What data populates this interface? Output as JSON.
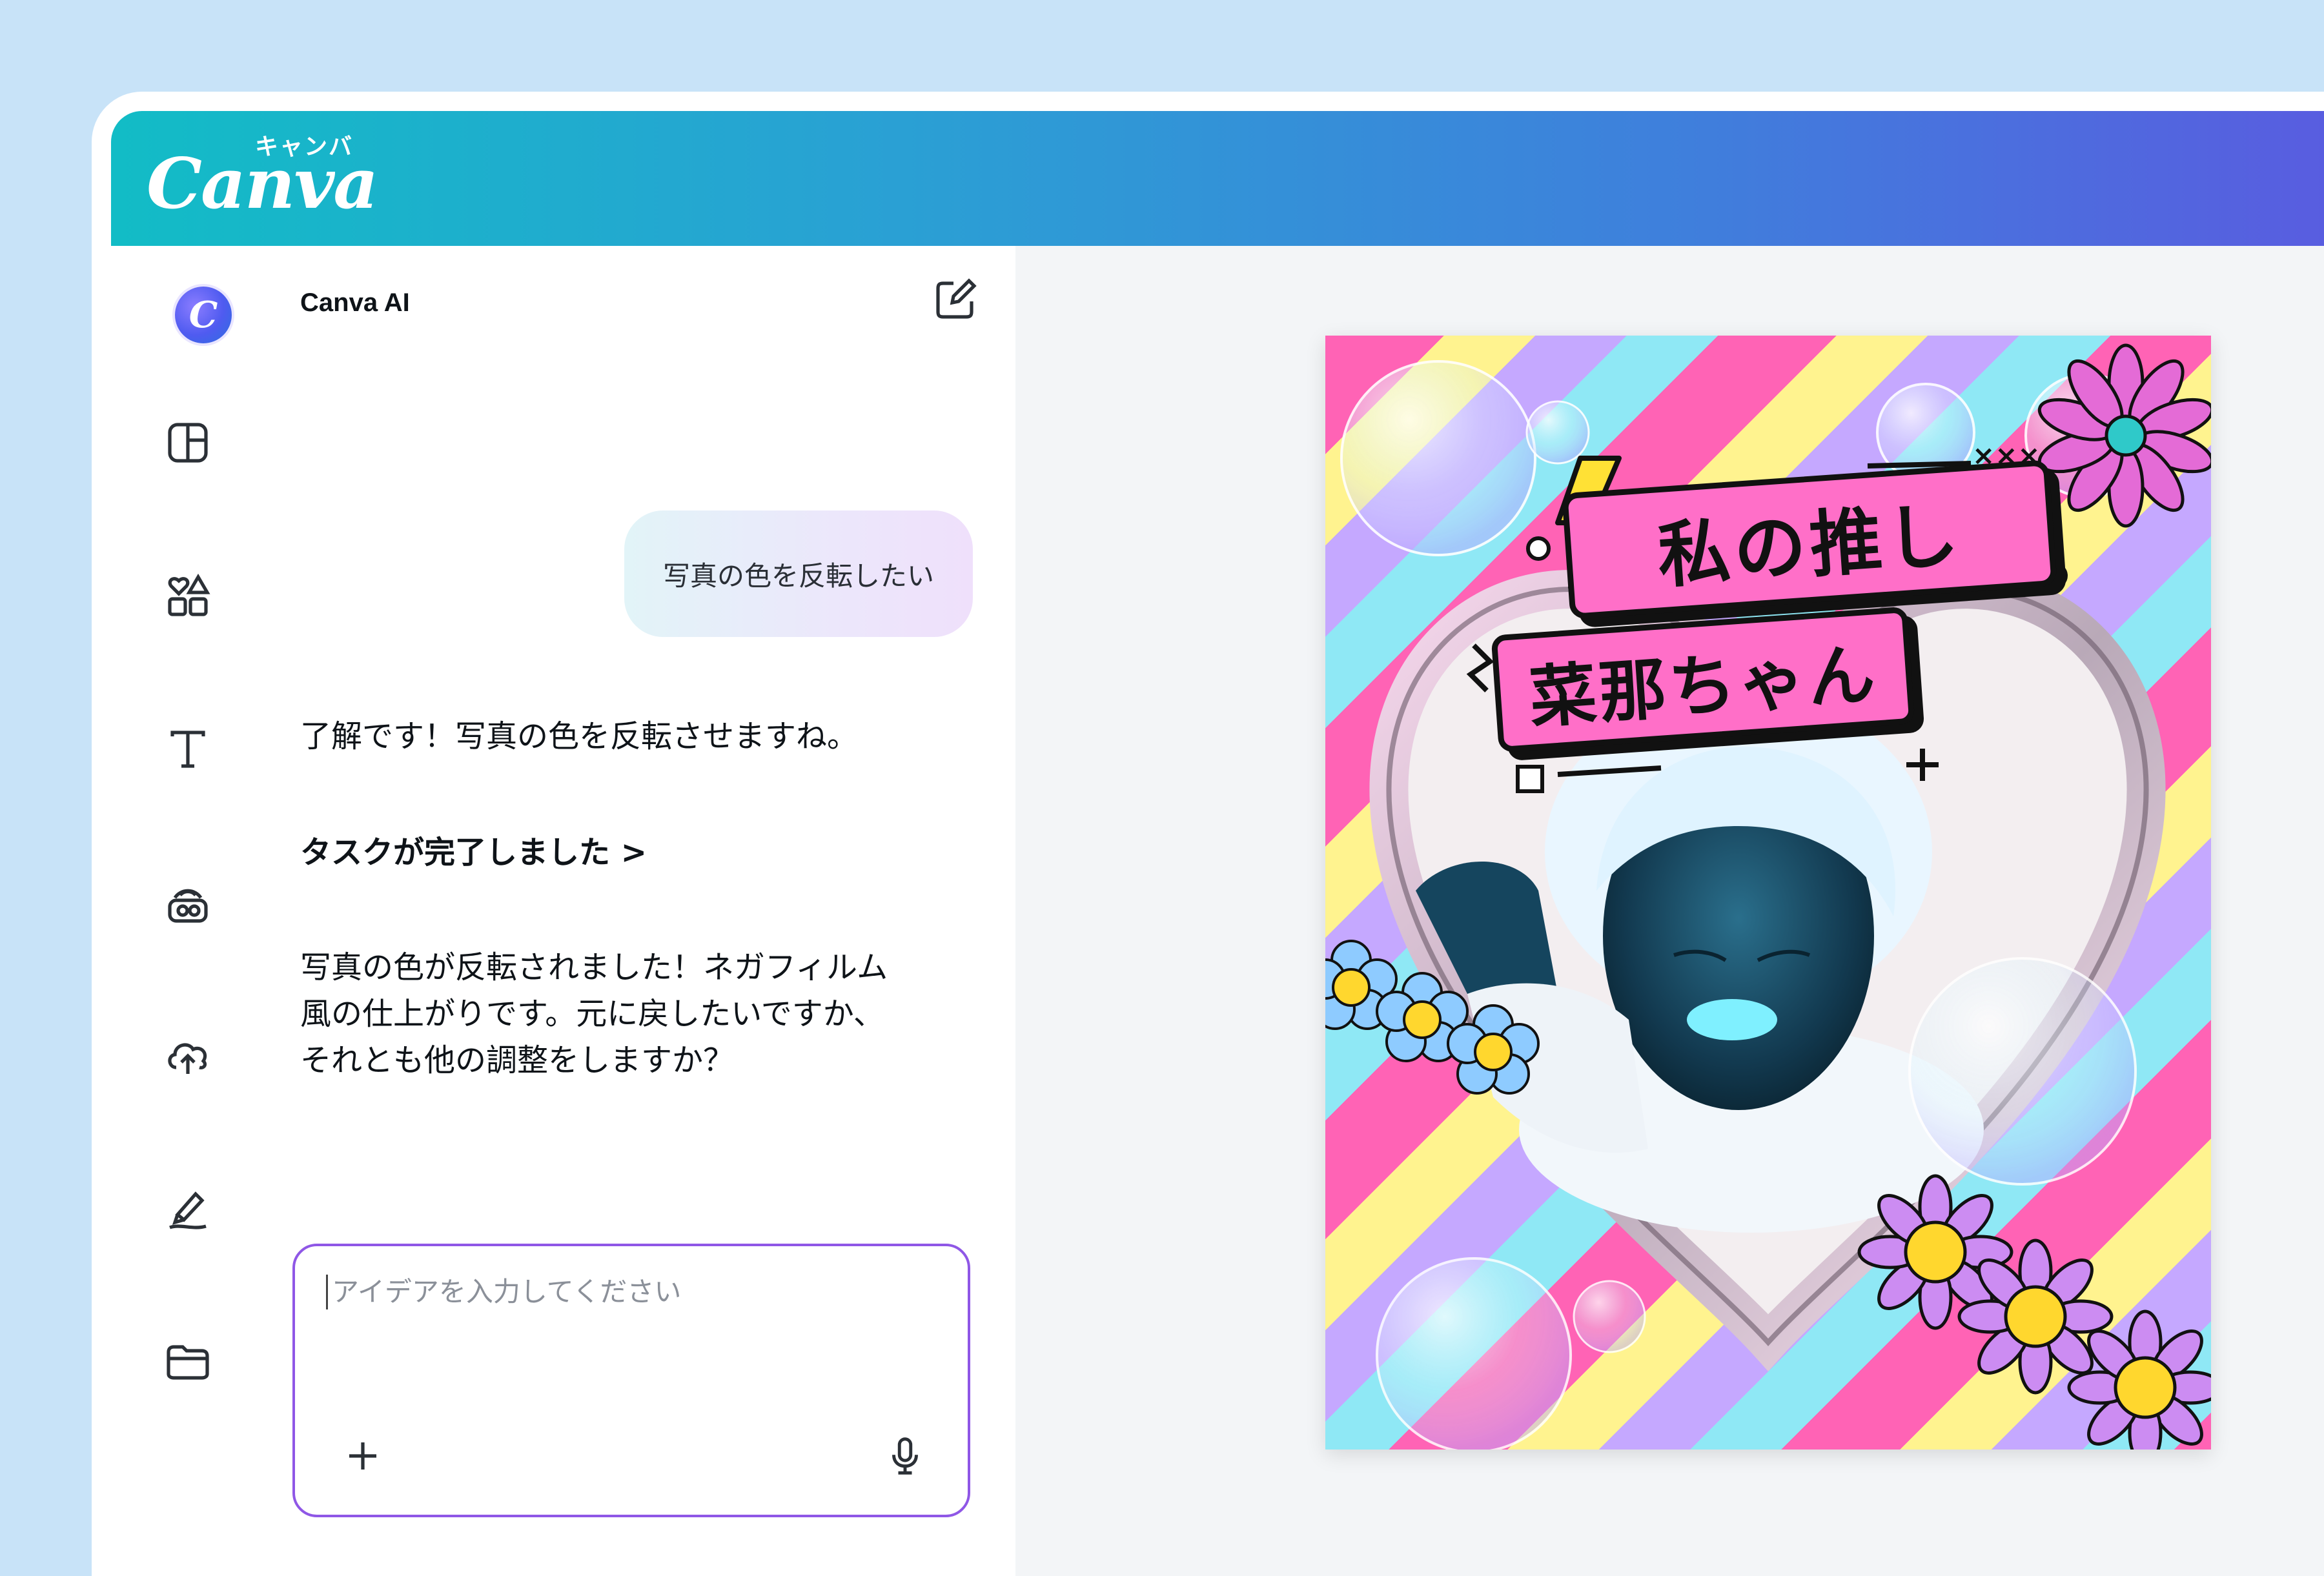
{
  "brand": {
    "kana": "キャンバ",
    "wordmark": "Canva",
    "gradient_start": "#12bcc6",
    "gradient_end": "#5a5be0"
  },
  "rail": {
    "items": [
      {
        "name": "canva-ai",
        "icon": "canva-ai-icon"
      },
      {
        "name": "design",
        "icon": "layout-icon"
      },
      {
        "name": "elements",
        "icon": "shapes-icon"
      },
      {
        "name": "text",
        "icon": "text-icon"
      },
      {
        "name": "brand",
        "icon": "brand-kit-icon"
      },
      {
        "name": "uploads",
        "icon": "cloud-upload-icon"
      },
      {
        "name": "draw",
        "icon": "draw-icon"
      },
      {
        "name": "projects",
        "icon": "folder-icon"
      }
    ]
  },
  "chat": {
    "title": "Canva AI",
    "user_message": "写真の色を反転したい",
    "assistant_reply_1": "了解です！写真の色を反転させますね。",
    "task_status": "タスクが完了しました >",
    "assistant_reply_2_line1": "写真の色が反転されました！ネガフィルム",
    "assistant_reply_2_line2": "風の仕上がりです。元に戻したいですか、",
    "assistant_reply_2_line3": "それとも他の調整をしますか？",
    "input_placeholder": "アイデアを入力してください"
  },
  "poster": {
    "headline_1": "私の推し",
    "headline_2": "菜那ちゃん",
    "accent_pink": "#ff6fc8",
    "stripe_colors": [
      "#ff63b5",
      "#fff38f",
      "#c5a8ff",
      "#8fe8f5"
    ]
  },
  "composer_accent": "#8f57e6"
}
